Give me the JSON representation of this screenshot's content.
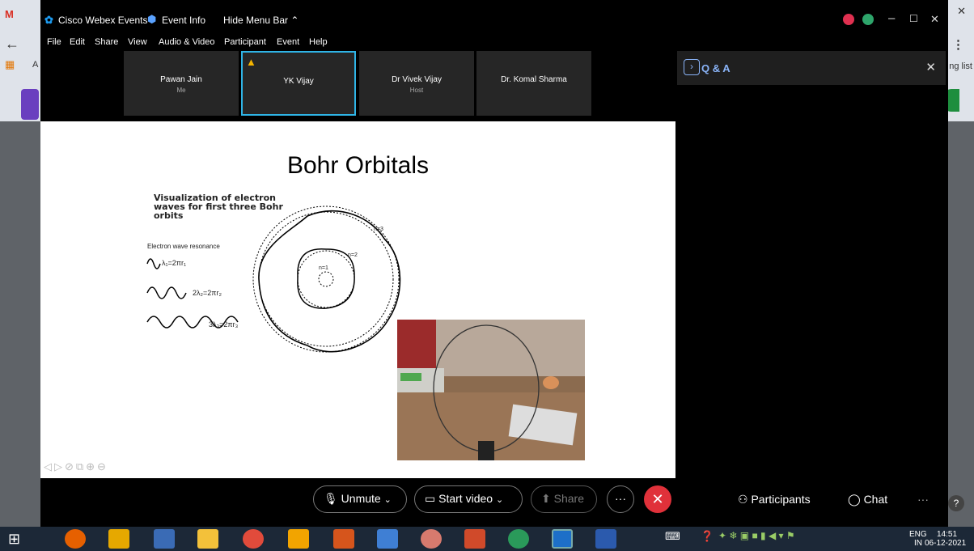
{
  "titlebar": {
    "app_name": "Cisco Webex Events",
    "event_info": "Event Info",
    "hide_menu": "Hide Menu Bar ⌃"
  },
  "menu": [
    "File",
    "Edit",
    "Share",
    "View",
    "Audio & Video",
    "Participant",
    "Event",
    "Help"
  ],
  "participants_strip": [
    {
      "name": "Pawan Jain",
      "role": "Me"
    },
    {
      "name": "YK Vijay",
      "role": ""
    },
    {
      "name": "Dr Vivek Vijay",
      "role": "Host"
    },
    {
      "name": "Dr. Komal Sharma",
      "role": ""
    }
  ],
  "slide": {
    "title": "Bohr Orbitals",
    "viz_label": "Visualization of electron waves for first three Bohr orbits",
    "resonance_label": "Electron wave resonance",
    "eq1": "λ₁=2πr₁",
    "eq2": "2λ₂=2πr₂",
    "eq3": "3λ₃=2πr₃",
    "n1": "n=1",
    "n2": "n=2",
    "n3": "n=3"
  },
  "qa_panel": {
    "title": "Q & A"
  },
  "controls": {
    "unmute": "Unmute",
    "start_video": "Start video",
    "share": "Share",
    "participants": "Participants",
    "chat": "Chat"
  },
  "browser_bg": {
    "apps_letter": "A",
    "right_text": "ng list"
  },
  "taskbar": {
    "lang_top": "ENG",
    "lang_bottom": "IN",
    "time": "14:51",
    "date": "06-12-2021"
  }
}
